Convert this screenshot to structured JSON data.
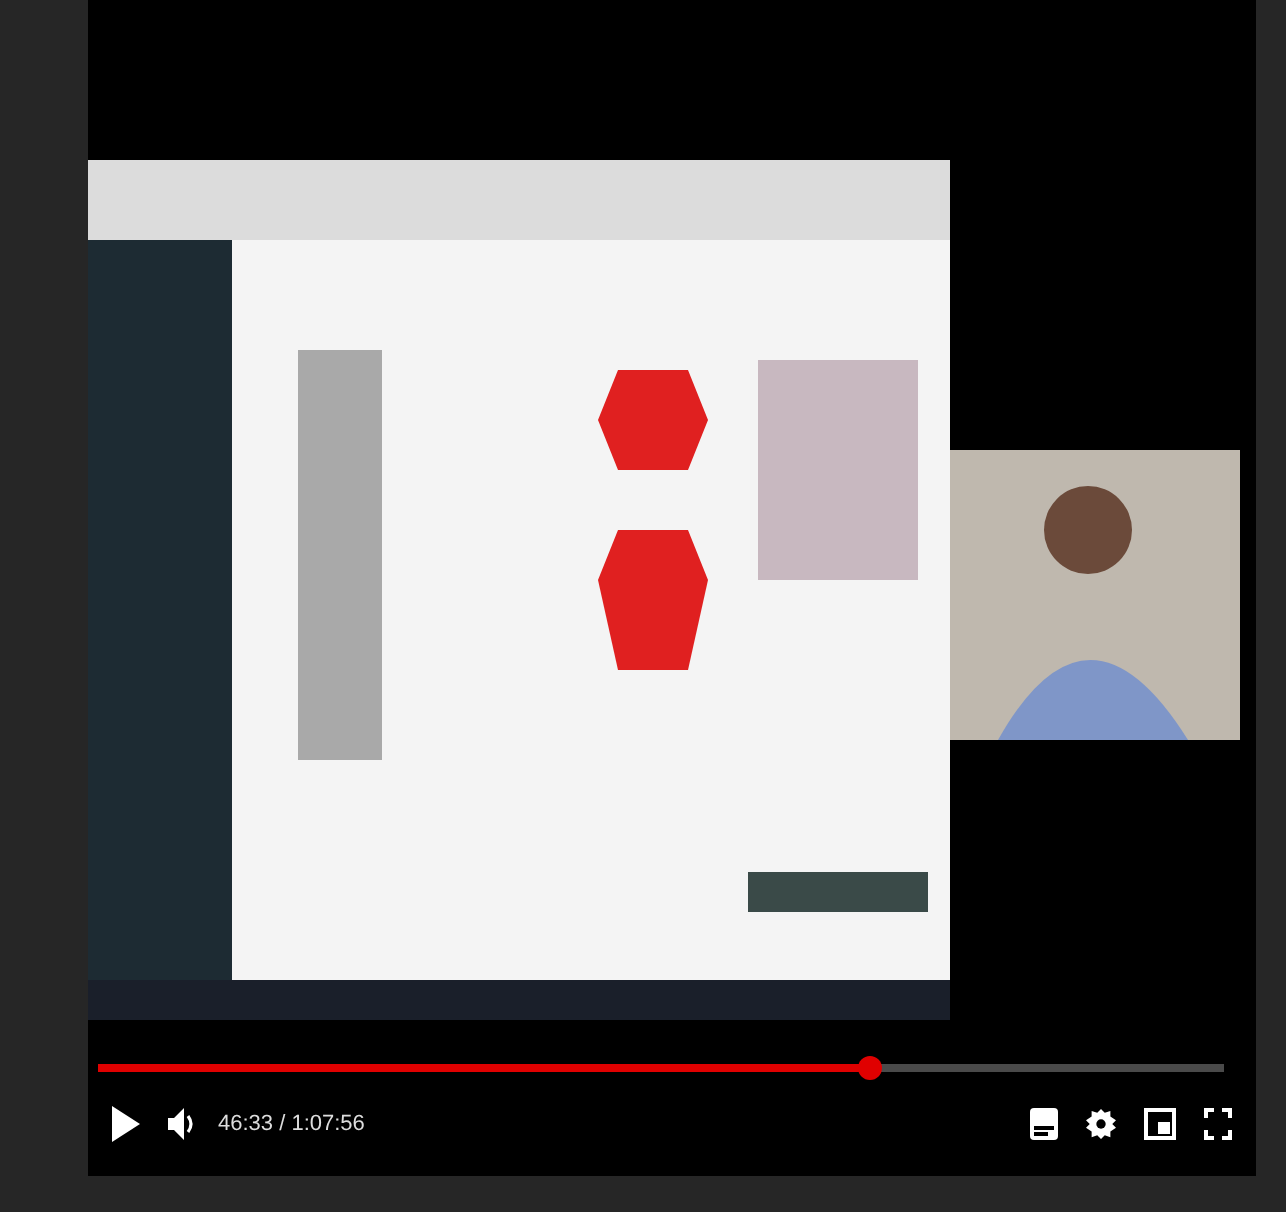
{
  "progress": {
    "level": 0.686
  },
  "time": "46:33 / 1:07:56"
}
